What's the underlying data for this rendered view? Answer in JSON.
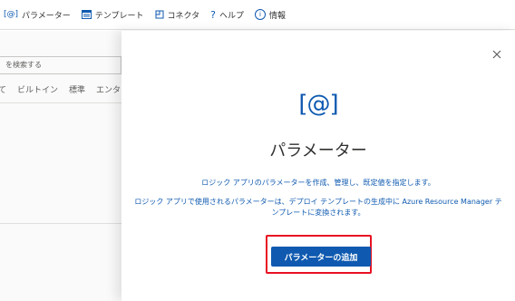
{
  "toolbar": {
    "items": [
      {
        "icon": "[@]",
        "label": "パラメーター"
      },
      {
        "label": "テンプレート"
      },
      {
        "label": "コネクタ"
      },
      {
        "icon": "?",
        "label": "ヘルプ"
      },
      {
        "icon": "i",
        "label": "情報"
      }
    ]
  },
  "left": {
    "search_text": "を検索する",
    "filter_tabs": [
      "て",
      "ビルトイン",
      "標準",
      "エンタ"
    ]
  },
  "panel": {
    "icon_text": "[@]",
    "title": "パラメーター",
    "description1": "ロジック アプリのパラメーターを作成、管理し、既定値を指定します。",
    "description2": "ロジック アプリで使用されるパラメーターは、デプロイ テンプレートの生成中に Azure Resource Manager テンプレートに変換されます。",
    "add_button": "パラメーターの追加"
  },
  "colors": {
    "accent": "#0f5ab0",
    "highlight": "#e81123"
  }
}
